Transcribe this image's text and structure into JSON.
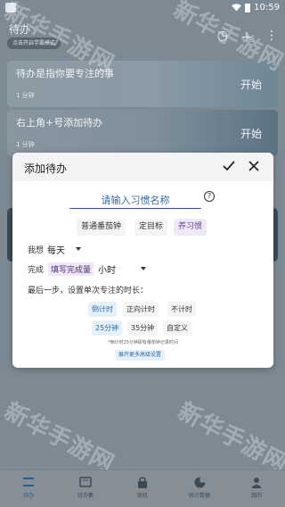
{
  "status_bar": {
    "time": "10:59",
    "wifi_icon": "wifi-icon",
    "battery_icon": "battery-icon"
  },
  "header": {
    "title": "待办",
    "chip": "点击开启学霸模式",
    "icons": [
      "clock-icon",
      "plus-icon",
      "more-icon"
    ]
  },
  "tasks": [
    {
      "title": "待办是指你要专注的事",
      "duration": "1 分钟",
      "start": "开始"
    },
    {
      "title": "右上角+号添加待办",
      "duration": "1 分钟",
      "start": "开始"
    }
  ],
  "dialog": {
    "title": "添加待办",
    "name_placeholder": "请输入习惯名称",
    "help": "?",
    "modes": [
      "普通番茄钟",
      "定目标",
      "养习惯"
    ],
    "selected_mode": "养习惯",
    "frequency_label": "我想",
    "frequency_value": "每天",
    "complete_label": "完成",
    "complete_tag": "填写完成量",
    "complete_unit": "小时",
    "duration_prompt": "最后一步，设置单次专注的时长：",
    "timer_types": [
      "倒计时",
      "正向计时",
      "不计时"
    ],
    "selected_timer": "倒计时",
    "durations": [
      "25分钟",
      "35分钟",
      "自定义"
    ],
    "selected_duration": "25分钟",
    "hint": "*倒计时25分钟即有番茄钟记录时间",
    "advanced": "展开更多高级设置"
  },
  "bottom_nav": [
    {
      "label": "待办",
      "icon": "list-icon",
      "active": true
    },
    {
      "label": "待办集",
      "icon": "collection-icon",
      "active": false
    },
    {
      "label": "锁机",
      "icon": "lock-icon",
      "active": false
    },
    {
      "label": "统计数据",
      "icon": "chart-pie-icon",
      "active": false
    },
    {
      "label": "我的",
      "icon": "person-icon",
      "active": false
    }
  ],
  "watermark": "新华手游网",
  "colors": {
    "accent": "#2a5c9a",
    "purple_select": "#6a3fa0",
    "blue_select": "#2a6aa8"
  }
}
